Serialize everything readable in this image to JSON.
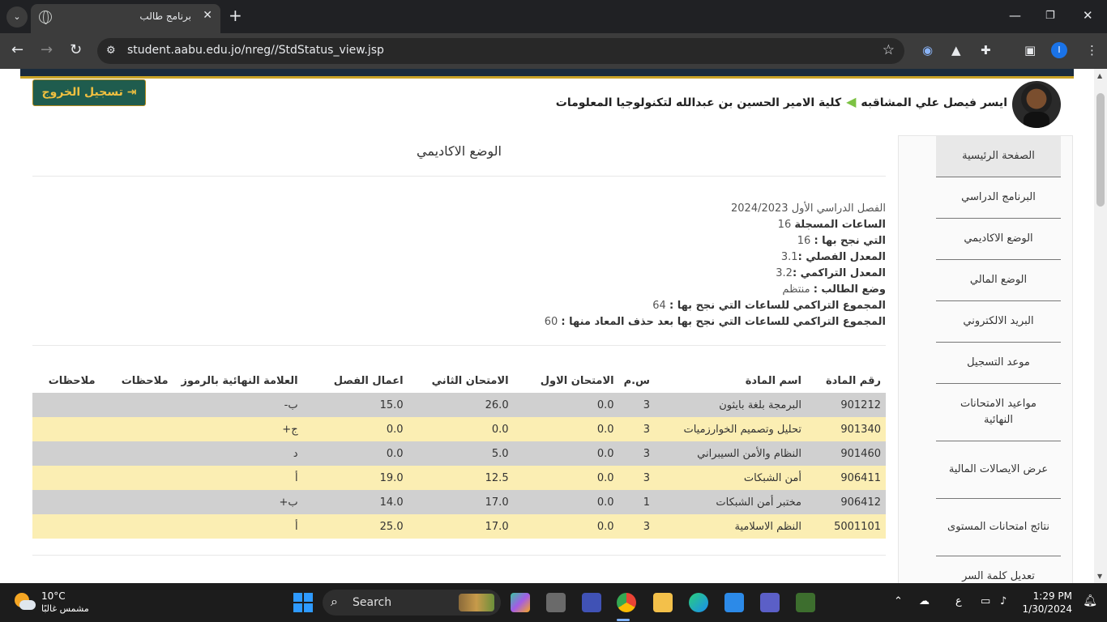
{
  "browser": {
    "tab_title": "برنامج طالب",
    "url": "student.aabu.edu.jo/nreg//StdStatus_view.jsp",
    "profile_initial": "I"
  },
  "header": {
    "logout_label": "تسجيل الخروج",
    "student_name": "ايسر فيصل علي المشاقبه",
    "college": "كلية الامير الحسين بن عبدالله لتكنولوجيا المعلومات"
  },
  "sidebar": {
    "items": [
      {
        "label": "الصفحة الرئيسية"
      },
      {
        "label": "البرنامج الدراسي"
      },
      {
        "label": "الوضع الاكاديمي"
      },
      {
        "label": "الوضع المالي"
      },
      {
        "label": "البريد الالكتروني"
      },
      {
        "label": "موعد التسجيل"
      },
      {
        "label": "مواعيد الامتحانات النهائية"
      },
      {
        "label": "عرض الايصالات المالية"
      },
      {
        "label": "نتائج امتحانات المستوى"
      },
      {
        "label": "تعديل كلمة السر"
      }
    ]
  },
  "main": {
    "title": "الوضع الاكاديمي",
    "semester": "الفصل الدراسي الأول 2024/2023",
    "registered_hours_label": "الساعات المسجلة",
    "registered_hours": "16",
    "passed_hours_label": "التي نجح بها :",
    "passed_hours": "16",
    "semester_gpa_label": "المعدل الفصلي :",
    "semester_gpa": "3.1",
    "cumulative_gpa_label": "المعدل التراكمي :",
    "cumulative_gpa": "3.2",
    "status_label": "وضع الطالب :",
    "status": "منتظم",
    "total_passed_label": "المجموع التراكمي للساعات التي نجح بها :",
    "total_passed": "64",
    "total_after_label": "المجموع التراكمي للساعات التي نجح بها بعد حذف المعاد منها :",
    "total_after": "60",
    "table": {
      "headers": [
        "رقم المادة",
        "اسم المادة",
        "س.م",
        "الامتحان الاول",
        "الامتحان الثاني",
        "اعمال الفصل",
        "العلامة النهائية بالرموز",
        "ملاحظات",
        "ملاحظات"
      ],
      "rows": [
        {
          "code": "901212",
          "name": "البرمجة بلغة بايثون",
          "hours": "3",
          "first": "0.0",
          "second": "26.0",
          "coursework": "15.0",
          "grade": "ب-",
          "note1": "",
          "note2": ""
        },
        {
          "code": "901340",
          "name": "تحليل وتصميم الخوارزميات",
          "hours": "3",
          "first": "0.0",
          "second": "0.0",
          "coursework": "0.0",
          "grade": "ج+",
          "note1": "",
          "note2": ""
        },
        {
          "code": "901460",
          "name": "النظام والأمن السيبراني",
          "hours": "3",
          "first": "0.0",
          "second": "5.0",
          "coursework": "0.0",
          "grade": "د",
          "note1": "",
          "note2": ""
        },
        {
          "code": "906411",
          "name": "أمن الشبكات",
          "hours": "3",
          "first": "0.0",
          "second": "12.5",
          "coursework": "19.0",
          "grade": "أ",
          "note1": "",
          "note2": ""
        },
        {
          "code": "906412",
          "name": "مختبر أمن الشبكات",
          "hours": "1",
          "first": "0.0",
          "second": "17.0",
          "coursework": "14.0",
          "grade": "ب+",
          "note1": "",
          "note2": ""
        },
        {
          "code": "5001101",
          "name": "النظم الاسلامية",
          "hours": "3",
          "first": "0.0",
          "second": "17.0",
          "coursework": "25.0",
          "grade": "أ",
          "note1": "",
          "note2": ""
        }
      ]
    }
  },
  "taskbar": {
    "temperature": "10°C",
    "weather": "مشمس غالبًا",
    "search_label": "Search",
    "language": "ع",
    "time": "1:29 PM",
    "date": "1/30/2024"
  }
}
